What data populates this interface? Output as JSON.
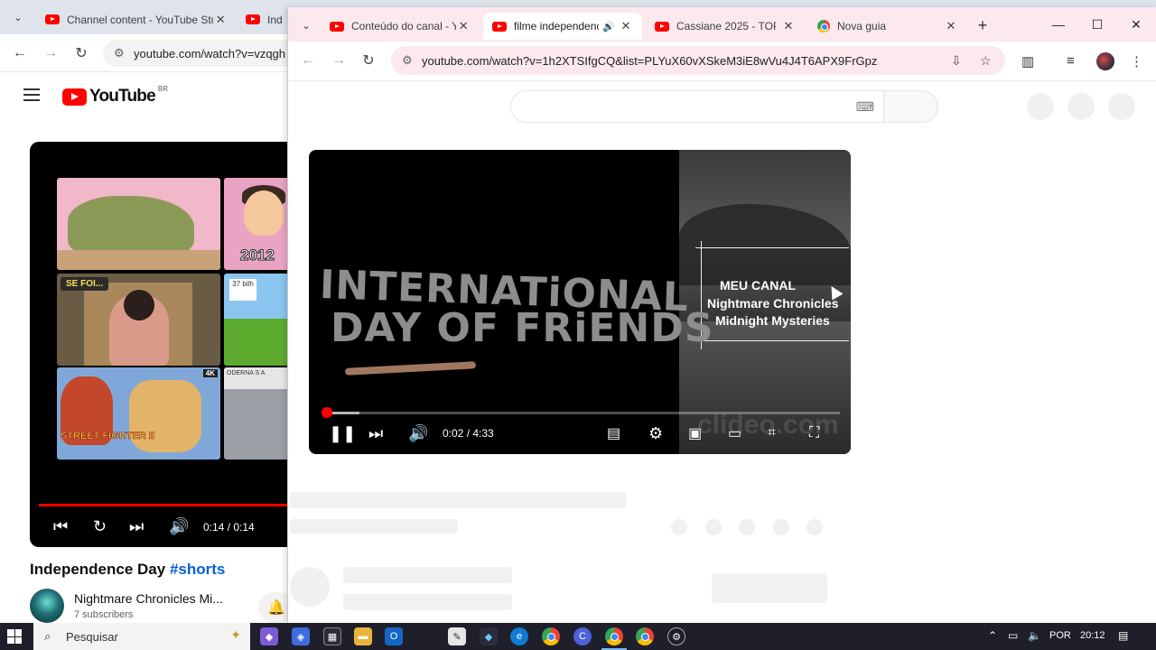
{
  "background_window": {
    "tabs": [
      {
        "title": "Channel content - YouTube Stu",
        "close": "✕"
      },
      {
        "title": "Indep",
        "close": ""
      }
    ],
    "address": "youtube.com/watch?v=vzqgh",
    "yt_logo": "YouTube",
    "region": "BR",
    "shorts_time": "0:14 / 0:14",
    "thumbs": {
      "t2_year": "2012",
      "t3_label": "SE FOI...",
      "t4_sign": "37 bilh",
      "t5_title": "STREET FIGHTER II",
      "t5_badge": "4K",
      "t6_sign": "ODERNA S A"
    },
    "short_title": "Independence Day",
    "short_hashtag": "#shorts",
    "channel_name": "Nightmare Chronicles Mi...",
    "subscribers": "7 subscribers"
  },
  "front_window": {
    "tabs": [
      {
        "title": "Conteúdo do canal - Y",
        "icon": "youtube-icon",
        "close": "✕"
      },
      {
        "title": "filme independenc",
        "icon": "youtube-icon",
        "close": "✕",
        "active": true
      },
      {
        "title": "Cassiane 2025 - TOP ",
        "icon": "youtube-icon",
        "close": "✕"
      },
      {
        "title": "Nova guia",
        "icon": "chrome-icon",
        "close": "✕"
      }
    ],
    "address": "youtube.com/watch?v=1h2XTSIfgCQ&list=PLYuX60vXSkeM3iE8wVu4J4T6APX9FrGpz",
    "player": {
      "title_line1": "INTERNATiONAL",
      "title_line2": "DAY OF FRiENDS",
      "overlay": [
        "MEU CANAL",
        "Nightmare Chronicles",
        "Midnight Mysteries"
      ],
      "watermark": "clideo.com",
      "time": "0:02 / 4:33",
      "progress": 0.0073,
      "buffered": 0.07
    }
  },
  "taskbar": {
    "search_placeholder": "Pesquisar",
    "language": "POR",
    "clock": "20:12"
  },
  "colors": {
    "youtube_red": "#ff0000",
    "front_tabbar": "#fbe9ee",
    "taskbar": "#1f1f2b",
    "link_blue": "#065fd4"
  }
}
